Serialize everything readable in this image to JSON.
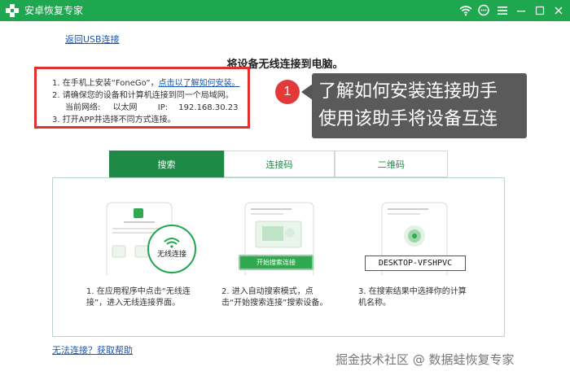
{
  "window": {
    "title": "安卓恢复专家",
    "controls": [
      "wifi-icon",
      "chat-icon",
      "menu-icon",
      "minimize-icon",
      "maximize-icon",
      "close-icon"
    ]
  },
  "back_link": "返回USB连接",
  "page_title": "将设备无线连接到电脑。",
  "steps": {
    "step1_text": "1.  在手机上安装“FoneGo”，",
    "step1_link": "点击以了解如何安装。",
    "step2_text": "2.  请确保您的设备和计算机连接到同一个局域网。",
    "network_label": "当前网络:",
    "network_value": "以太网",
    "ip_label": "IP:",
    "ip_value": "192.168.30.23",
    "step3_text": "3.  打开APP并选择不同方式连接。"
  },
  "annotation": {
    "number": "1",
    "line1": "了解如何安装连接助手",
    "line2": "使用该助手将设备互连"
  },
  "tabs": [
    {
      "label": "搜索",
      "active": true
    },
    {
      "label": "连接码",
      "active": false
    },
    {
      "label": "二维码",
      "active": false
    }
  ],
  "illustrations": {
    "phone1_badge": "无线连接",
    "phone2_button": "开始搜索连接",
    "phone3_device": "DESKTOP-VFSHPVC"
  },
  "captions": {
    "c1_line1": "1.  在应用程序中点击“无线连",
    "c1_line2": "接”，进入无线连接界面。",
    "c2_line1": "2.  进入自动搜索模式，点",
    "c2_line2": "击“开始搜索连接”搜索设备。",
    "c3_line1": "3.  在搜索结果中选择你的计算",
    "c3_line2": "机名称。"
  },
  "help_link": "无法连接？获取帮助",
  "watermark": "掘金技术社区 @ 数据蛙恢复专家",
  "colors": {
    "titlebar": "#1ea74e",
    "tab_active": "#1e8a46",
    "highlight_border": "#e0312f",
    "link": "#1a56b0",
    "annotation_bg": "#5a5a5a",
    "annotation_circle": "#e23a3a"
  }
}
